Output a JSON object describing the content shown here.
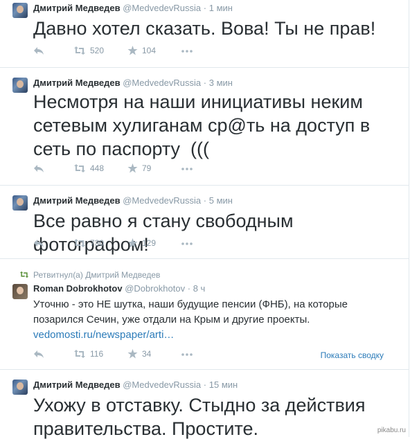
{
  "colors": {
    "name": "#292f33",
    "meta": "#8899a6",
    "link": "#2b7bb9",
    "border": "#e1e8ed",
    "retweet": "#5c913b"
  },
  "tweets": [
    {
      "name": "Дмитрий Медведев",
      "handle": "@MedvedevRussia",
      "time": "1 мин",
      "text": "Давно хотел сказать. Вова! Ты не прав!",
      "retweets": "520",
      "favorites": "104"
    },
    {
      "name": "Дмитрий Медведев",
      "handle": "@MedvedevRussia",
      "time": "3 мин",
      "text": "Несмотря на наши инициативы неким сетевым хулиганам ср@ть на доступ в сеть по паспорту  (((",
      "retweets": "448",
      "favorites": "79"
    },
    {
      "name": "Дмитрий Медведев",
      "handle": "@MedvedevRussia",
      "time": "5 мин",
      "text": "Все равно я стану свободным фотографом!",
      "retweets": "730",
      "favorites": "129"
    },
    {
      "retweeted_by": "Ретвитнул(а) Дмитрий Медведев",
      "name": "Roman Dobrokhotov",
      "handle": "@Dobrokhotov",
      "time": "8 ч",
      "text": "Уточню - это НЕ шутка, наши будущие пенсии (ФНБ), на которые позарился Сечин, уже отдали на Крым и другие проекты.",
      "link": "vedomosti.ru/newspaper/arti…",
      "retweets": "116",
      "favorites": "34",
      "show_conversation": "Показать сводку"
    },
    {
      "name": "Дмитрий Медведев",
      "handle": "@MedvedevRussia",
      "time": "15 мин",
      "text": "Ухожу в отставку. Стыдно за действия правительства. Простите."
    }
  ],
  "watermark": "pikabu.ru",
  "icons": {
    "reply": "reply-icon",
    "retweet": "retweet-icon",
    "favorite": "star-icon",
    "more": "more-icon"
  },
  "separator": "·"
}
